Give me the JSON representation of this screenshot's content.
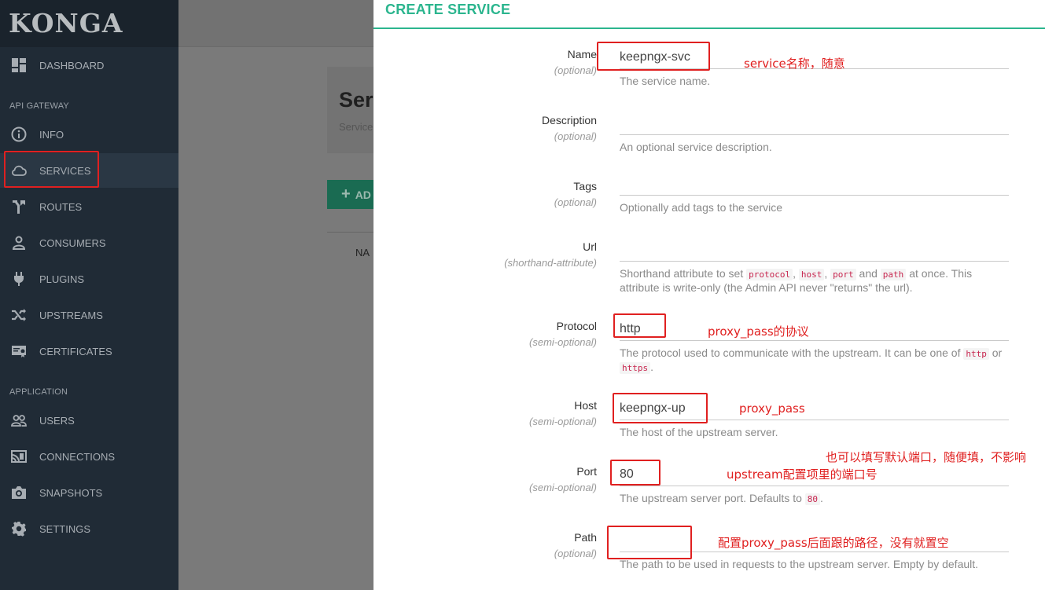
{
  "sidebar": {
    "logo": "KONGA",
    "dashboard": "DASHBOARD",
    "section_api": "API GATEWAY",
    "info": "INFO",
    "services": "SERVICES",
    "routes": "ROUTES",
    "consumers": "CONSUMERS",
    "plugins": "PLUGINS",
    "upstreams": "UPSTREAMS",
    "certificates": "CERTIFICATES",
    "section_app": "APPLICATION",
    "users": "USERS",
    "connections": "CONNECTIONS",
    "snapshots": "SNAPSHOTS",
    "settings": "SETTINGS"
  },
  "background": {
    "title": "Ser",
    "subtitle": "Service",
    "add_label": "AD",
    "column_head": "NA"
  },
  "modal": {
    "title": "CREATE SERVICE",
    "name": {
      "label": "Name",
      "sub": "(optional)",
      "value": "keepngx-svc",
      "help": "The service name."
    },
    "description": {
      "label": "Description",
      "sub": "(optional)",
      "value": "",
      "help": "An optional service description."
    },
    "tags": {
      "label": "Tags",
      "sub": "(optional)",
      "value": "",
      "help": "Optionally add tags to the service"
    },
    "url": {
      "label": "Url",
      "sub": "(shorthand-attribute)",
      "value": "",
      "help_pre": "Shorthand attribute to set",
      "code1": "protocol",
      "code2": "host",
      "code3": "port",
      "and": "and",
      "code4": "path",
      "help_post": "at once. This attribute is write-only (the Admin API never \"returns\" the url)."
    },
    "protocol": {
      "label": "Protocol",
      "sub": "(semi-optional)",
      "value": "http",
      "help_pre": "The protocol used to communicate with the upstream. It can be one of",
      "code1": "http",
      "or": "or",
      "code2": "https"
    },
    "host": {
      "label": "Host",
      "sub": "(semi-optional)",
      "value": "keepngx-up",
      "help": "The host of the upstream server."
    },
    "port": {
      "label": "Port",
      "sub": "(semi-optional)",
      "value": "80",
      "help_pre": "The upstream server port. Defaults to",
      "code1": "80"
    },
    "path": {
      "label": "Path",
      "sub": "(optional)",
      "value": "",
      "help": "The path to be used in requests to the upstream server. Empty by default."
    }
  },
  "annotations": {
    "name": "service名称，随意",
    "protocol": "proxy_pass的协议",
    "host": "proxy_pass",
    "port_line1": "也可以填写默认端口，随便填，不影响",
    "port_line2": "upstream配置项里的端口号",
    "path": "配置proxy_pass后面跟的路径，没有就置空"
  },
  "colors": {
    "accent": "#2bb58e",
    "annotation": "#e02020",
    "sidebar": "#202b36"
  }
}
